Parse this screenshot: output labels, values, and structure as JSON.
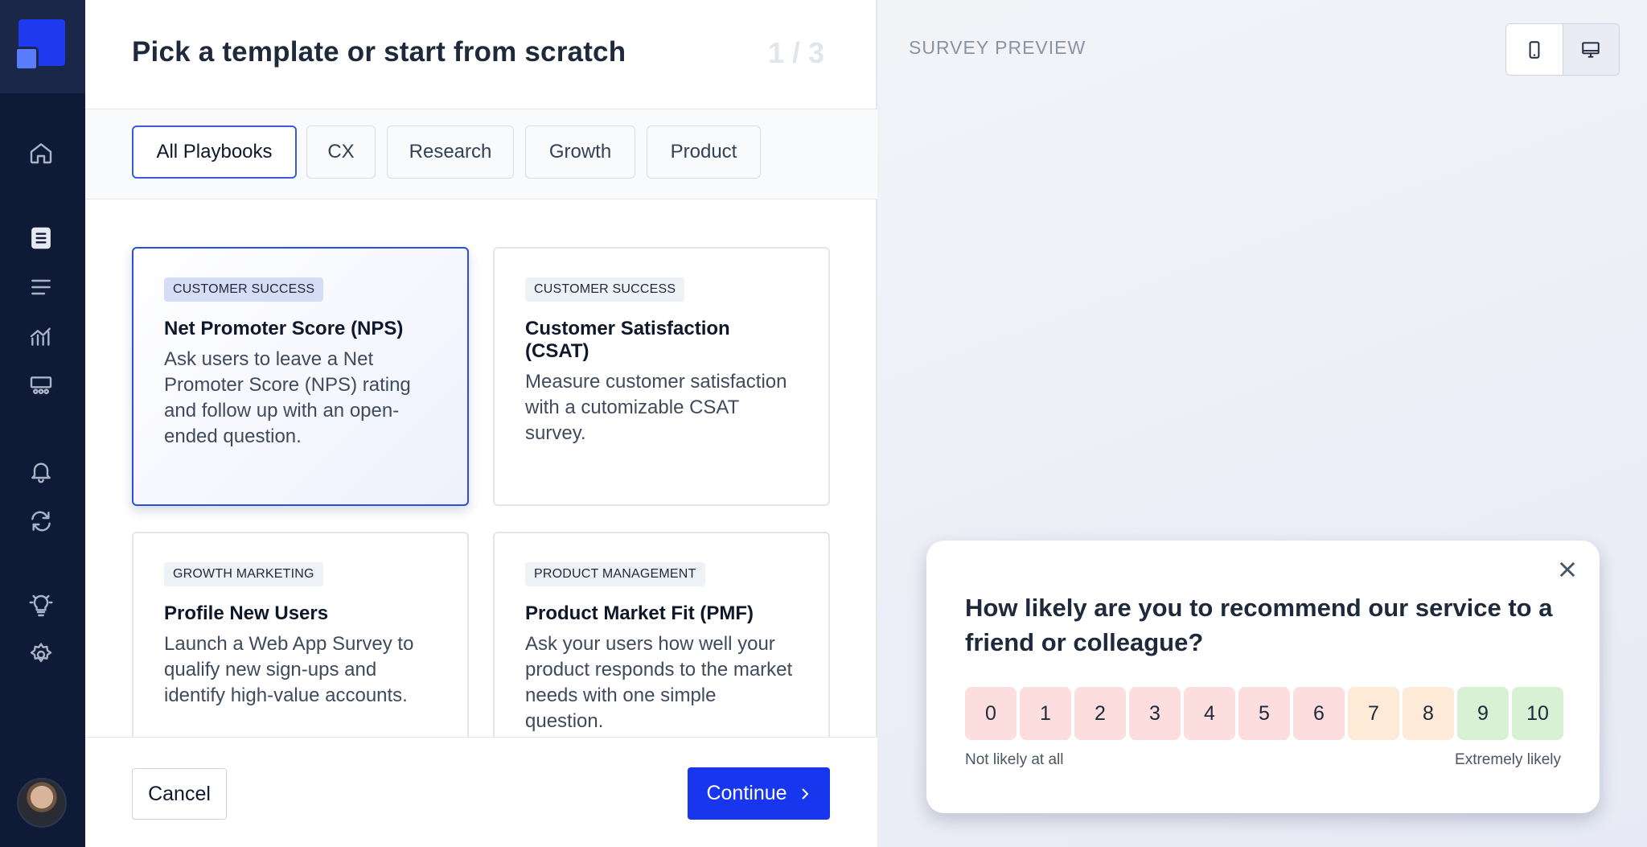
{
  "sidebar": {
    "icons": [
      "home-icon",
      "surveys-icon",
      "list-icon",
      "analytics-icon",
      "team-icon",
      "bell-icon",
      "sync-icon",
      "lightbulb-icon",
      "settings-icon"
    ]
  },
  "header": {
    "title": "Pick a template or start from scratch",
    "step": "1 / 3"
  },
  "filters": [
    "All Playbooks",
    "CX",
    "Research",
    "Growth",
    "Product"
  ],
  "cards": [
    {
      "tag": "CUSTOMER SUCCESS",
      "title": "Net Promoter Score (NPS)",
      "desc": "Ask users to leave a Net Promoter Score (NPS) rating and follow up with an open-ended question."
    },
    {
      "tag": "CUSTOMER SUCCESS",
      "title": "Customer Satisfaction (CSAT)",
      "desc": "Measure customer satisfaction with a cutomizable CSAT survey."
    },
    {
      "tag": "GROWTH MARKETING",
      "title": "Profile New Users",
      "desc": "Launch a Web App Survey to qualify new sign-ups and identify high-value accounts."
    },
    {
      "tag": "PRODUCT MANAGEMENT",
      "title": "Product Market Fit (PMF)",
      "desc": "Ask your users how well your product responds to the market needs with one simple question."
    }
  ],
  "footer": {
    "cancel": "Cancel",
    "continue": "Continue"
  },
  "preview": {
    "label": "SURVEY PREVIEW",
    "question": "How likely are you to recommend our service to a friend or colleague?",
    "scale": [
      "0",
      "1",
      "2",
      "3",
      "4",
      "5",
      "6",
      "7",
      "8",
      "9",
      "10"
    ],
    "low_label": "Not likely at all",
    "high_label": "Extremely likely",
    "colors": {
      "red": "#fcdede",
      "orange": "#feebd7",
      "green": "#d8f1d4"
    }
  }
}
